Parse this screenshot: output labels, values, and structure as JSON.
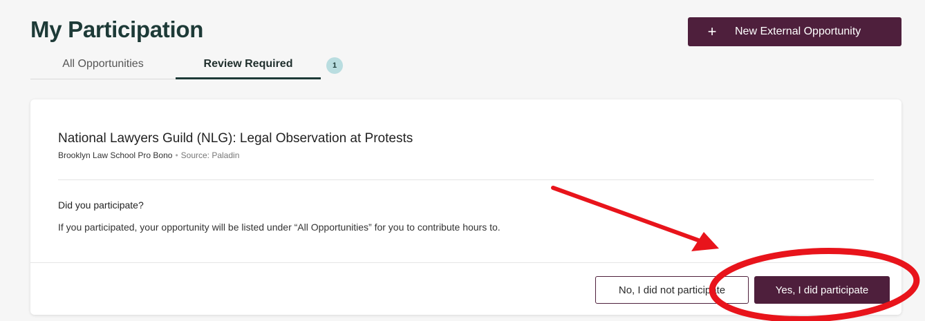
{
  "page": {
    "title": "My Participation",
    "new_button": {
      "icon": "plus-icon",
      "label": "New External Opportunity"
    }
  },
  "tabs": [
    {
      "label": "All Opportunities",
      "active": false
    },
    {
      "label": "Review Required",
      "active": true
    }
  ],
  "review_badge_count": "1",
  "opportunity": {
    "title": "National Lawyers Guild (NLG): Legal Observation at Protests",
    "organization": "Brooklyn Law School Pro Bono",
    "separator": "•",
    "source": "Source: Paladin",
    "question": "Did you participate?",
    "explanation": "If you participated, your opportunity will be listed under “All Opportunities” for you to contribute hours to.",
    "no_label": "No, I did not participate",
    "yes_label": "Yes, I did participate"
  },
  "colors": {
    "brand": "#4e1f3c",
    "heading": "#1d3a37",
    "badge": "#b9dde0",
    "annotation": "#e8141b"
  }
}
